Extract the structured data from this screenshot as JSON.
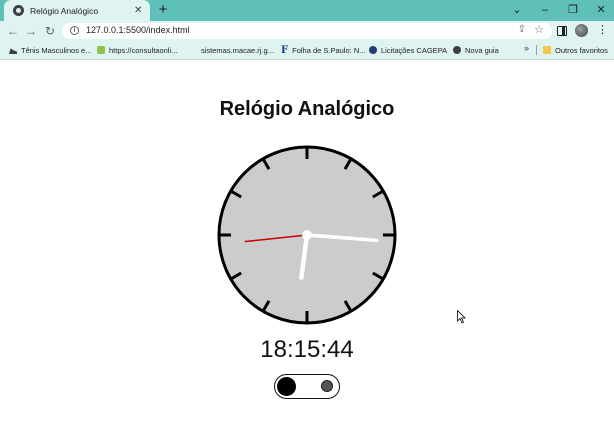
{
  "browser": {
    "tab_title": "Relógio Analógico",
    "tab_close": "✕",
    "new_tab": "+",
    "url": "127.0.0.1:5500/index.html",
    "window_controls": {
      "dropdown": "⌄",
      "minimize": "–",
      "restore": "❐",
      "close": "✕"
    },
    "nav": {
      "back": "←",
      "forward": "→",
      "reload": "↻"
    },
    "bookmarks": [
      {
        "label": "Tênis Masculinos e...",
        "icon": "shoe-icon"
      },
      {
        "label": "https://consultaonli...",
        "icon": "green-site-icon"
      },
      {
        "label": "sistemas.macae.rj.g...",
        "icon": "blank-icon"
      },
      {
        "label": "Folha de S.Paulo: N...",
        "icon": "folha-icon"
      },
      {
        "label": "Licitações CAGEPA",
        "icon": "seal-icon"
      },
      {
        "label": "Nova guia",
        "icon": "globe-icon"
      }
    ],
    "bookmarks_more": "»",
    "other_favorites": "Outros favoritos"
  },
  "page": {
    "title": "Relógio Analógico",
    "time": "18:15:44",
    "clock": {
      "hours": 18,
      "minutes": 15,
      "seconds": 44
    },
    "theme_toggle": {
      "state": "light"
    }
  },
  "colors": {
    "tab_strip": "#5fbfb9",
    "toolbar": "#dff3f1",
    "clock_face": "#cccccc",
    "hand": "#ffffff",
    "second_hand": "#cc0000"
  }
}
